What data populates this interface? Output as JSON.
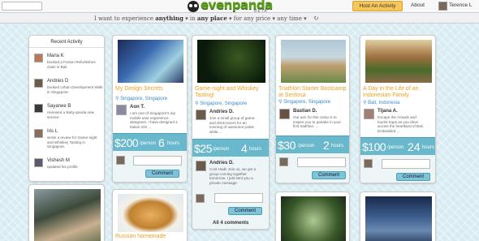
{
  "header": {
    "logo": "evenpanda",
    "beta": "BETA",
    "host_button": "Host An Activity",
    "about": "About",
    "user_name": "Terence L"
  },
  "filters": {
    "prefix": "I want to experience",
    "what": "anything",
    "in": "in",
    "where": "any place",
    "for": "for",
    "price": "any price",
    "time": "any time"
  },
  "activity": {
    "title": "Recent Activity",
    "items": [
      {
        "name": "Maria K",
        "text": "booked a Fusion Refurbishes class in Bali."
      },
      {
        "name": "Andries D",
        "text": "booked Urban Development Walk in Singapore."
      },
      {
        "name": "Sayanee B",
        "text": "reviewed a Baby-panda new service."
      },
      {
        "name": "Iris L",
        "text": "wrote a review for Game-night and Whiskey Tasting in Singapore."
      },
      {
        "name": "Vishesh M",
        "text": "updated his profile."
      }
    ]
  },
  "cards": [
    {
      "title": "My Design Secrets",
      "loc": "Singapore, Singapore",
      "host": "Aon T.",
      "desc": "I am one of Singapore's top mobile user experience designers. I have designed 4 Italian iOS ...",
      "price": "$200",
      "per": "/person",
      "dur": "6",
      "unit": "hours",
      "comment": "Comment"
    },
    {
      "title": "Game-night and Whiskey Tasting!",
      "loc": "Singapore, Singapore",
      "host": "Andries D.",
      "desc": "Join a small group of game- and drink-lovers for an evening of awesome poker, while ...",
      "price": "$25",
      "per": "/person",
      "dur": "4",
      "unit": "hours",
      "comment_host": "Andries D.",
      "comment_text": "Cool Hadi! Join us, we got a group coming together tomorrow. I just sent you a private message.",
      "comment": "Comment",
      "all_comments": "All 4 comments"
    },
    {
      "title": "Triathlon Starter Bootcamp at Sentosa",
      "loc": "Singapore, Singapore",
      "host": "Bastian D.",
      "desc": "Our aim for this camp is to inspire you to partake in your first triathlon. ...",
      "price": "$30",
      "per": "/person",
      "dur": "2",
      "unit": "hours",
      "comment": "Comment"
    },
    {
      "title": "A Day in the Life of an Indonesian Family",
      "loc": "Bali, Indonesia",
      "host": "Tijana A.",
      "desc": "Escape the crowds and tourist traps as you drive across the heartland of Bali. Embedded ...",
      "price": "$100",
      "per": "/person",
      "dur": "24",
      "unit": "hours",
      "comment": "Comment"
    }
  ],
  "row2": {
    "title_2": "Russian homemade"
  },
  "colors": {
    "accent": "#6ab8cc",
    "title": "#f0a020",
    "link": "#3a8ccc",
    "brand": "#5a9e1c",
    "host_btn": "#f7c65a"
  }
}
